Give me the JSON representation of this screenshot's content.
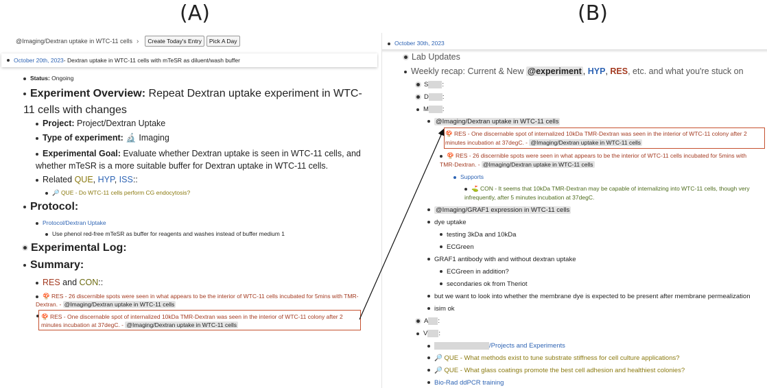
{
  "labels": {
    "a": "(A)",
    "b": "(B)"
  },
  "a": {
    "breadcrumb": "@Imaging/Dextran uptake in WTC-11 cells",
    "btn_today": "Create Today's Entry",
    "btn_pick": "Pick A Day",
    "date": "October 20th, 2023",
    "date_rest": " - Dextran uptake in WTC-11 cells with mTeSR as diluent/wash buffer",
    "status_label": "Status:",
    "status_val": " Ongoing",
    "overview_label": "Experiment Overview:",
    "overview_text": " Repeat Dextran uptake experiment in WTC-11 cells with changes",
    "project_label": "Project:",
    "project_val": " Project/Dextran Uptake",
    "type_label": "Type of experiment:",
    "type_val": " 🔬 Imaging",
    "goal_label": "Experimental Goal:",
    "goal_val": " Evaluate whether Dextran uptake is seen in WTC-11 cells, and whether mTeSR is a more suitable buffer for Dextran uptake in WTC-11 cells.",
    "related": "Related ",
    "que": "QUE",
    "hyp": "HYP",
    "iss": "ISS",
    "que_item": "🔎 QUE - Do WTC-11 cells perform CG endocytosis?",
    "protocol": "Protocol:",
    "protocol_link": "Protocol/Dextran Uptake",
    "protocol_note": "Use phenol red-free mTeSR as buffer for reagents and washes instead of buffer medium 1",
    "log": "Experimental Log:",
    "summary": "Summary:",
    "res": "RES",
    "and": " and ",
    "con": "CON",
    "res1": "🍄 RES - 26 discernible spots were seen in what appears to be the interior of WTC-11 cells incubated for 5mins with TMR-Dextran. - ",
    "res1_tag": "@Imaging/Dextran uptake in WTC-11 cells",
    "res2": "🍄 RES - One discernable spot of internalized 10kDa TMR-Dextran was seen in the interior of WTC-11 colony after 2 minutes incubation at 37degC. - ",
    "res2_tag": "@Imaging/Dextran uptake in WTC-11 cells"
  },
  "b": {
    "date": "October 30th, 2023",
    "lab_updates": "Lab Updates",
    "weekly": "Weekly recap: Current & New ",
    "experiment": "@experiment",
    "hyp": "HYP",
    "res": "RES",
    "weekly_rest": ", etc. and what you're stuck on",
    "s": "S",
    "d": "D",
    "m": "M",
    "imaging": "@Imaging/Dextran uptake in WTC-11 cells",
    "res_one": "🍄 RES - One discernable spot of internalized 10kDa TMR-Dextran was seen in the interior of WTC-11 colony after 2 minutes incubation at 37degC. - ",
    "res_one_tag": "@Imaging/Dextran uptake in WTC-11 cells",
    "res_26": "🍄 RES - 26 discernible spots were seen in what appears to be the interior of WTC-11 cells incubated for 5mins with TMR-Dextran. - ",
    "res_26_tag": "@Imaging/Dextran uptake in WTC-11 cells",
    "supports": "Supports",
    "con": "⛳ CON - It seems that 10kDa TMR-Dextran may be capable of internalizing into WTC-11 cells, though very infrequently, after 5 minutes incubation at 37degC.",
    "graf1": "@Imaging/GRAF1 expression in WTC-11 cells",
    "dye": "dye uptake",
    "testing": "testing 3kDa and 10kDa",
    "ecgreen": "ECGreen",
    "graf1_ab": "GRAF1 antibody with and without dextran uptake",
    "ecgreen_add": "ECGreen in addition?",
    "secondaries": "secondaries ok from Theriot",
    "membrane": "but we want to look into whether the membrane dye is expected to be present after membrane permealization",
    "isim": "isim ok",
    "a": "A",
    "v": "V",
    "projects": "/Projects and Experiments",
    "que1": "🔎 QUE - What methods exist to tune substrate stiffness for cell culture applications?",
    "que2": "🔎 QUE - What glass coatings promote the best cell adhesion and healthiest colonies?",
    "biorad": "Bio-Rad ddPCR training"
  }
}
